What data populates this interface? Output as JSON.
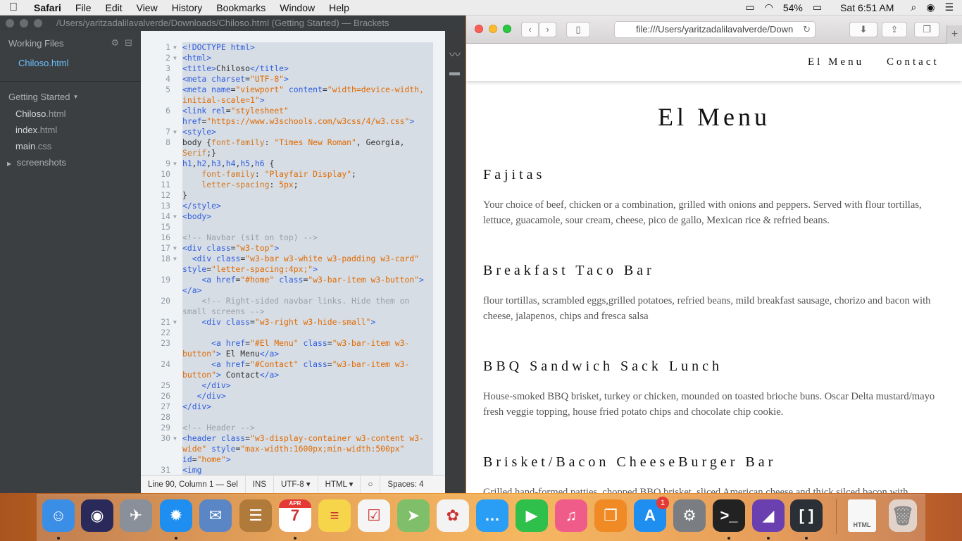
{
  "menubar": {
    "app": "Safari",
    "items": [
      "File",
      "Edit",
      "View",
      "History",
      "Bookmarks",
      "Window",
      "Help"
    ],
    "battery": "54%",
    "clock": "Sat 6:51 AM"
  },
  "brackets": {
    "title": "/Users/yaritzadalilavalverde/Downloads/Chiloso.html (Getting Started) — Brackets",
    "working_files_label": "Working Files",
    "working_files": [
      "Chiloso.html"
    ],
    "project_label": "Getting Started",
    "tree": [
      {
        "name": "Chiloso",
        "ext": ".html"
      },
      {
        "name": "index",
        "ext": ".html"
      },
      {
        "name": "main",
        "ext": ".css"
      }
    ],
    "folder": "screenshots",
    "status": {
      "position": "Line 90, Column 1 — Sel",
      "mode": "INS",
      "encoding": "UTF-8",
      "language": "HTML",
      "spaces": "Spaces:  4"
    },
    "code": [
      {
        "n": "1",
        "html": "<span class=\"tag\">&lt;!DOCTYPE html&gt;</span>"
      },
      {
        "n": "2",
        "html": "<span class=\"tag\">&lt;html&gt;</span>"
      },
      {
        "n": "3",
        "html": "<span class=\"tag\">&lt;title&gt;</span>Chiloso<span class=\"tag\">&lt;/title&gt;</span>"
      },
      {
        "n": "4",
        "html": "<span class=\"tag\">&lt;meta</span> <span class=\"attr\">charset</span>=<span class=\"str\">\"UTF-8\"</span><span class=\"tag\">&gt;</span>"
      },
      {
        "n": "5",
        "html": "<span class=\"tag\">&lt;meta</span> <span class=\"attr\">name</span>=<span class=\"str\">\"viewport\"</span> <span class=\"attr\">content</span>=<span class=\"str\">\"width=device-width, initial-scale=1\"</span><span class=\"tag\">&gt;</span>"
      },
      {
        "n": "6",
        "html": "<span class=\"tag\">&lt;link</span> <span class=\"attr\">rel</span>=<span class=\"str\">\"stylesheet\"</span> <span class=\"attr\">href</span>=<span class=\"str\">\"https://www.w3schools.com/w3css/4/w3.css\"</span><span class=\"tag\">&gt;</span>"
      },
      {
        "n": "7",
        "html": "<span class=\"tag\">&lt;style&gt;</span>"
      },
      {
        "n": "8",
        "html": "body {<span class=\"prop\">font-family</span>: <span class=\"str\">\"Times New Roman\"</span>, Georgia, <span class=\"prop\">Serif</span>;}"
      },
      {
        "n": "9",
        "html": "<span class=\"tag\">h1</span>,<span class=\"tag\">h2</span>,<span class=\"tag\">h3</span>,<span class=\"tag\">h4</span>,<span class=\"tag\">h5</span>,<span class=\"tag\">h6</span> {"
      },
      {
        "n": "10",
        "html": "    <span class=\"prop\">font-family</span>: <span class=\"str\">\"Playfair Display\"</span>;"
      },
      {
        "n": "11",
        "html": "    <span class=\"prop\">letter-spacing</span>: <span class=\"str\">5px</span>;"
      },
      {
        "n": "12",
        "html": "}"
      },
      {
        "n": "13",
        "html": "<span class=\"tag\">&lt;/style&gt;</span>"
      },
      {
        "n": "14",
        "html": "<span class=\"tag\">&lt;body&gt;</span>"
      },
      {
        "n": "15",
        "html": ""
      },
      {
        "n": "16",
        "html": "<span class=\"cmt\">&lt;!-- Navbar (sit on top) --&gt;</span>"
      },
      {
        "n": "17",
        "html": "<span class=\"tag\">&lt;div</span> <span class=\"attr\">class</span>=<span class=\"str\">\"w3-top\"</span><span class=\"tag\">&gt;</span>"
      },
      {
        "n": "18",
        "html": "  <span class=\"tag\">&lt;div</span> <span class=\"attr\">class</span>=<span class=\"str\">\"w3-bar w3-white w3-padding w3-card\"</span> <span class=\"attr\">style</span>=<span class=\"str\">\"letter-spacing:4px;\"</span><span class=\"tag\">&gt;</span>"
      },
      {
        "n": "19",
        "html": "    <span class=\"tag\">&lt;a</span> <span class=\"attr\">href</span>=<span class=\"str\">\"#home\"</span> <span class=\"attr\">class</span>=<span class=\"str\">\"w3-bar-item w3-button\"</span><span class=\"tag\">&gt;&lt;/a&gt;</span>"
      },
      {
        "n": "20",
        "html": "    <span class=\"cmt\">&lt;!-- Right-sided navbar links. Hide them on small screens --&gt;</span>"
      },
      {
        "n": "21",
        "html": "    <span class=\"tag\">&lt;div</span> <span class=\"attr\">class</span>=<span class=\"str\">\"w3-right w3-hide-small\"</span><span class=\"tag\">&gt;</span>"
      },
      {
        "n": "22",
        "html": ""
      },
      {
        "n": "23",
        "html": "      <span class=\"tag\">&lt;a</span> <span class=\"attr\">href</span>=<span class=\"str\">\"#El Menu\"</span> <span class=\"attr\">class</span>=<span class=\"str\">\"w3-bar-item w3-button\"</span><span class=\"tag\">&gt;</span> El Menu<span class=\"tag\">&lt;/a&gt;</span>"
      },
      {
        "n": "24",
        "html": "      <span class=\"tag\">&lt;a</span> <span class=\"attr\">href</span>=<span class=\"str\">\"#Contact\"</span> <span class=\"attr\">class</span>=<span class=\"str\">\"w3-bar-item w3-button\"</span><span class=\"tag\">&gt;</span> Contact<span class=\"tag\">&lt;/a&gt;</span>"
      },
      {
        "n": "25",
        "html": "    <span class=\"tag\">&lt;/div&gt;</span>"
      },
      {
        "n": "26",
        "html": "   <span class=\"tag\">&lt;/div&gt;</span>"
      },
      {
        "n": "27",
        "html": "<span class=\"tag\">&lt;/div&gt;</span>"
      },
      {
        "n": "28",
        "html": ""
      },
      {
        "n": "29",
        "html": "<span class=\"cmt\">&lt;!-- Header --&gt;</span>"
      },
      {
        "n": "30",
        "html": "<span class=\"tag\">&lt;header</span> <span class=\"attr\">class</span>=<span class=\"str\">\"w3-display-container w3-content w3-wide\"</span> <span class=\"attr\">style</span>=<span class=\"str\">\"max-width:1600px;min-width:500px\"</span> <span class=\"attr\">id</span>=<span class=\"str\">\"home\"</span><span class=\"tag\">&gt;</span>"
      },
      {
        "n": "31",
        "html": "<span class=\"tag\">&lt;img</span>"
      }
    ]
  },
  "safari": {
    "url": "file:///Users/yaritzadalilavalverde/Down",
    "nav": [
      "El Menu",
      "Contact"
    ],
    "page_title": "El Menu",
    "dishes": [
      {
        "name": "Fajitas",
        "desc": "Your choice of beef, chicken or a combination, grilled with onions and peppers. Served with flour tortillas, lettuce, guacamole, sour cream, cheese, pico de gallo, Mexican rice & refried beans."
      },
      {
        "name": "Breakfast Taco Bar",
        "desc": "flour tortillas, scrambled eggs,grilled potatoes, refried beans, mild breakfast sausage, chorizo and bacon with cheese, jalapenos, chips and fresca salsa"
      },
      {
        "name": "BBQ Sandwich Sack Lunch",
        "desc": "House-smoked BBQ brisket, turkey or chicken, mounded on toasted brioche buns. Oscar Delta mustard/mayo fresh veggie topping, house fried potato chips and chocolate chip cookie."
      },
      {
        "name": "Brisket/Bacon CheeseBurger Bar",
        "desc": "Grilled hand-formed patties, chopped BBQ brisket, sliced American cheese and thick silced bacon with"
      }
    ]
  },
  "dock": {
    "apps": [
      {
        "name": "Finder",
        "glyph": "☺",
        "color": "#3a8ee6"
      },
      {
        "name": "Siri",
        "glyph": "◉",
        "color": "#2a2a5a"
      },
      {
        "name": "Launchpad",
        "glyph": "✈",
        "color": "#8a9099"
      },
      {
        "name": "Safari",
        "glyph": "✹",
        "color": "#1f8ef1"
      },
      {
        "name": "Mail",
        "glyph": "✉",
        "color": "#5a86c5"
      },
      {
        "name": "Contacts",
        "glyph": "☰",
        "color": "#b07a3a"
      },
      {
        "name": "Calendar",
        "glyph": "7",
        "color": "#ffffff",
        "badge_text": "APR"
      },
      {
        "name": "Notes",
        "glyph": "≡",
        "color": "#f7d54a"
      },
      {
        "name": "Reminders",
        "glyph": "☑",
        "color": "#f5f5f5"
      },
      {
        "name": "Maps",
        "glyph": "➤",
        "color": "#7fbf6a"
      },
      {
        "name": "Photos",
        "glyph": "✿",
        "color": "#f3f3f3"
      },
      {
        "name": "Messages",
        "glyph": "…",
        "color": "#2a9df4"
      },
      {
        "name": "FaceTime",
        "glyph": "▶",
        "color": "#2fbf4b"
      },
      {
        "name": "iTunes",
        "glyph": "♫",
        "color": "#f05c8a"
      },
      {
        "name": "iBooks",
        "glyph": "❐",
        "color": "#f08a24"
      },
      {
        "name": "App Store",
        "glyph": "A",
        "color": "#1f8ef1",
        "badge": "1"
      },
      {
        "name": "System Preferences",
        "glyph": "⚙",
        "color": "#7a7d82"
      },
      {
        "name": "Terminal",
        "glyph": ">_",
        "color": "#222222"
      },
      {
        "name": "Visual Studio",
        "glyph": "◢",
        "color": "#6a3fb0"
      },
      {
        "name": "Brackets",
        "glyph": "[ ]",
        "color": "#2b2f36"
      }
    ],
    "file_label": "HTML",
    "trash": "Trash"
  }
}
